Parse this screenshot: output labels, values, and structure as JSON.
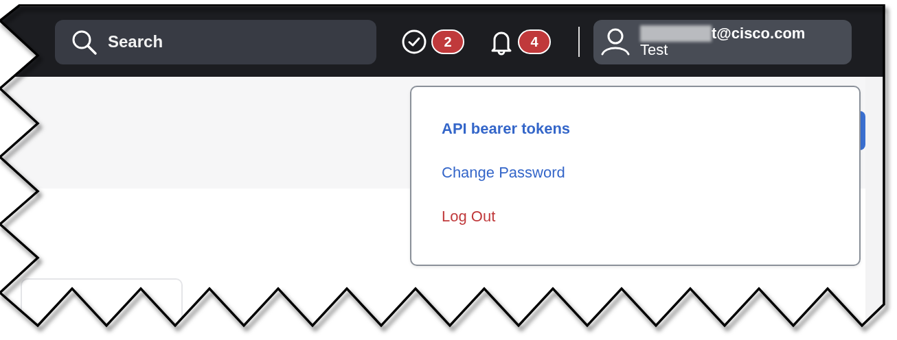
{
  "search": {
    "placeholder": "Search"
  },
  "header_icons": [
    {
      "kind": "tasks",
      "badge": "2"
    },
    {
      "kind": "notifications",
      "badge": "4"
    }
  ],
  "user": {
    "email": "t@cisco.com",
    "email_redacted": true,
    "subtitle": "Test"
  },
  "user_menu": {
    "items": [
      {
        "label": "API bearer tokens",
        "kind": "link",
        "selected": true
      },
      {
        "label": "Change Password",
        "kind": "link",
        "selected": false
      },
      {
        "label": "Log Out",
        "kind": "danger",
        "selected": false
      }
    ]
  }
}
